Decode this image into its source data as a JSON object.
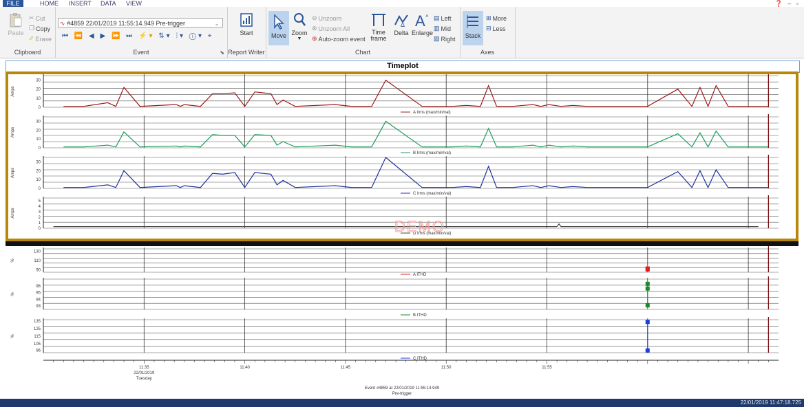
{
  "menubar": {
    "tabs": [
      {
        "label": "FILE"
      },
      {
        "label": "HOME"
      },
      {
        "label": "INSERT"
      },
      {
        "label": "DATA"
      },
      {
        "label": "VIEW"
      }
    ]
  },
  "ribbon": {
    "clipboard": {
      "paste": "Paste",
      "cut": "Cut",
      "copy": "Copy",
      "erase": "Erase",
      "group_label": "Clipboard"
    },
    "event": {
      "selected": "#4859 22/01/2019 11:55:14.949  Pre-trigger",
      "group_label": "Event"
    },
    "report": {
      "start": "Start",
      "group_label": "Report Writer"
    },
    "chart": {
      "move": "Move",
      "zoom": "Zoom",
      "unzoom": "Unzoom",
      "unzoom_all": "Unzoom All",
      "auto_zoom": "Auto-zoom event",
      "time_frame": "Time frame",
      "delta": "Delta",
      "enlarge": "Enlarge",
      "left": "Left",
      "mid": "Mid",
      "right": "Right",
      "group_label": "Chart"
    },
    "axes": {
      "stack": "Stack",
      "more": "More",
      "less": "Less",
      "group_label": "Axes"
    }
  },
  "timeplot": {
    "title": "Timeplot",
    "watermark": "DEMO"
  },
  "chart_data": [
    {
      "type": "line",
      "title": "",
      "ylabel": "Amps",
      "ylim": [
        0,
        35
      ],
      "yticks": [
        0,
        10,
        20,
        30
      ],
      "series": [
        {
          "name": "A Irms (max/min/val)",
          "color": "#a01818",
          "x": [
            1.0,
            2.0,
            3.2,
            3.6,
            4.0,
            4.8,
            6.6,
            6.8,
            7.0,
            7.8,
            8.4,
            8.9,
            9.5,
            10.0,
            10.5,
            11.3,
            11.6,
            11.9,
            12.5,
            14.5,
            15.3,
            15.6,
            15.9,
            16.3,
            17.0,
            18.8,
            20.3,
            21.0,
            21.7,
            22.1,
            22.5,
            23.3,
            24.3,
            24.7,
            25.1,
            25.7,
            26.3,
            27.0,
            28.5,
            30.0,
            31.5,
            32.2,
            32.6,
            33.0,
            33.4,
            34.0,
            35.5,
            36.0
          ],
          "y": [
            1,
            1,
            5,
            1,
            22,
            1,
            3,
            1,
            3,
            1,
            15,
            15,
            16,
            1,
            17,
            15,
            3,
            8,
            1,
            3,
            1,
            1,
            1,
            1,
            30,
            1,
            1,
            2,
            1,
            24,
            1,
            1,
            3,
            1,
            3,
            1,
            2,
            1,
            1,
            1,
            20,
            1,
            22,
            1,
            24,
            1,
            1,
            1
          ]
        }
      ]
    },
    {
      "type": "line",
      "title": "",
      "ylabel": "Amps",
      "ylim": [
        0,
        35
      ],
      "yticks": [
        0,
        10,
        20,
        30
      ],
      "series": [
        {
          "name": "B Irms (max/min/val)",
          "color": "#1d9a5a",
          "x": [
            1.0,
            2.0,
            3.2,
            3.6,
            4.0,
            4.8,
            6.6,
            6.8,
            7.0,
            7.8,
            8.4,
            8.9,
            9.5,
            10.0,
            10.5,
            11.3,
            11.6,
            11.9,
            12.5,
            14.5,
            15.3,
            15.6,
            15.9,
            16.3,
            17.0,
            18.8,
            20.3,
            21.0,
            21.7,
            22.1,
            22.5,
            23.3,
            24.3,
            24.7,
            25.1,
            25.7,
            26.3,
            27.0,
            28.5,
            30.0,
            31.5,
            32.2,
            32.6,
            33.0,
            33.4,
            34.0,
            35.5,
            36.0
          ],
          "y": [
            1,
            1,
            3,
            1,
            18,
            1,
            2,
            1,
            2,
            1,
            15,
            14,
            14,
            1,
            15,
            14,
            3,
            7,
            1,
            3,
            1,
            1,
            1,
            1,
            30,
            1,
            1,
            2,
            1,
            22,
            1,
            1,
            3,
            1,
            3,
            1,
            2,
            1,
            1,
            1,
            16,
            1,
            17,
            1,
            19,
            1,
            1,
            1
          ]
        }
      ]
    },
    {
      "type": "line",
      "title": "",
      "ylabel": "Amps",
      "ylim": [
        0,
        35
      ],
      "yticks": [
        0,
        10,
        20,
        30
      ],
      "series": [
        {
          "name": "C Irms (max/min/val)",
          "color": "#1e2f9c",
          "x": [
            1.0,
            2.0,
            3.2,
            3.6,
            4.0,
            4.8,
            6.6,
            6.8,
            7.0,
            7.8,
            8.4,
            8.9,
            9.5,
            10.0,
            10.5,
            11.3,
            11.6,
            11.9,
            12.5,
            14.5,
            15.3,
            15.6,
            15.9,
            16.3,
            17.0,
            18.8,
            20.3,
            21.0,
            21.7,
            22.1,
            22.5,
            23.3,
            24.3,
            24.7,
            25.1,
            25.7,
            26.3,
            27.0,
            28.5,
            30.0,
            31.5,
            32.2,
            32.6,
            33.0,
            33.4,
            34.0,
            35.5,
            36.0
          ],
          "y": [
            1,
            1,
            4,
            1,
            20,
            1,
            3,
            1,
            3,
            1,
            17,
            16,
            18,
            1,
            18,
            16,
            4,
            9,
            1,
            3,
            1,
            1,
            1,
            1,
            35,
            1,
            1,
            2,
            1,
            25,
            1,
            1,
            3,
            1,
            3,
            1,
            2,
            1,
            1,
            1,
            19,
            1,
            20,
            1,
            21,
            1,
            1,
            1
          ]
        }
      ]
    },
    {
      "type": "line",
      "title": "",
      "ylabel": "Amps",
      "ylim": [
        0,
        5.5
      ],
      "yticks": [
        0,
        1,
        2,
        3,
        4,
        5
      ],
      "series": [
        {
          "name": "D Irms (max/min/val)",
          "color": "#444444",
          "x": [
            0.5,
            6.0,
            12.0,
            18.0,
            24.0,
            25.5,
            25.6,
            25.7,
            30.0,
            35.5
          ],
          "y": [
            0.3,
            0.3,
            0.3,
            0.3,
            0.3,
            0.3,
            0.8,
            0.3,
            0.3,
            0.3
          ]
        }
      ]
    },
    {
      "type": "scatter",
      "title": "",
      "ylabel": "%",
      "ylim": [
        85,
        135
      ],
      "yticks": [
        90,
        110,
        130
      ],
      "series": [
        {
          "name": "A ITHD",
          "color": "#e02020",
          "x": [
            30.0,
            30.0
          ],
          "y": [
            91,
            93
          ]
        }
      ]
    },
    {
      "type": "scatter",
      "title": "",
      "ylabel": "%",
      "ylim": [
        92.5,
        97
      ],
      "yticks": [
        93.0,
        94.0,
        95.0,
        96.0
      ],
      "series": [
        {
          "name": "B ITHD",
          "color": "#1a8a2a",
          "x": [
            30.0,
            30.0,
            30.0
          ],
          "y": [
            96.3,
            95.6,
            93.1
          ]
        }
      ]
    },
    {
      "type": "scatter",
      "title": "",
      "ylabel": "%",
      "ylim": [
        93,
        137
      ],
      "yticks": [
        96,
        105,
        115,
        125,
        135
      ],
      "series": [
        {
          "name": "C ITHD",
          "color": "#1b3ee0",
          "x": [
            30.0,
            30.0
          ],
          "y": [
            134,
            96
          ]
        }
      ]
    }
  ],
  "x_axis": {
    "tick_labels": [
      "11:35",
      "11:40",
      "11:45",
      "11:50",
      "11:55"
    ],
    "date_label": "22/01/2019",
    "day_label": "Tuesday",
    "event_label": "Event #4859 at 22/01/2019 11:55:14.949",
    "pre_trigger": "Pre-trigger",
    "xlim": [
      0,
      36.5
    ],
    "major_ticks": [
      5,
      10,
      15,
      20,
      25,
      30,
      35
    ]
  },
  "status": {
    "timestamp": "22/01/2019 11:47:18.725"
  }
}
